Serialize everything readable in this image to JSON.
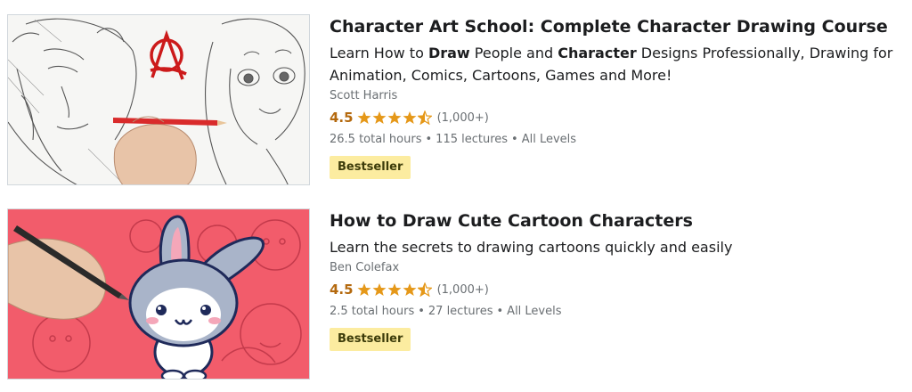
{
  "courses": [
    {
      "title": "Character Art School: Complete Character Drawing Course",
      "desc_parts": [
        "Learn How to ",
        "Draw",
        " People and ",
        "Character",
        " Designs Professionally, Drawing for Animation, Comics, Cartoons, Games and More!"
      ],
      "author": "Scott Harris",
      "rating": "4.5",
      "stars": 4.5,
      "rating_count": "(1,000+)",
      "hours": "26.5 total hours",
      "lectures": "115 lectures",
      "level": "All Levels",
      "badge": "Bestseller"
    },
    {
      "title": "How to Draw Cute Cartoon Characters",
      "desc": "Learn the secrets to drawing cartoons quickly and easily",
      "author": "Ben Colefax",
      "rating": "4.5",
      "stars": 4.5,
      "rating_count": "(1,000+)",
      "hours": "2.5 total hours",
      "lectures": "27 lectures",
      "level": "All Levels",
      "badge": "Bestseller"
    }
  ],
  "separator": "•",
  "colors": {
    "star": "#e59819",
    "rating": "#b4690e",
    "badge_bg": "#fceca0",
    "thumb2_bg": "#f25c6b"
  }
}
